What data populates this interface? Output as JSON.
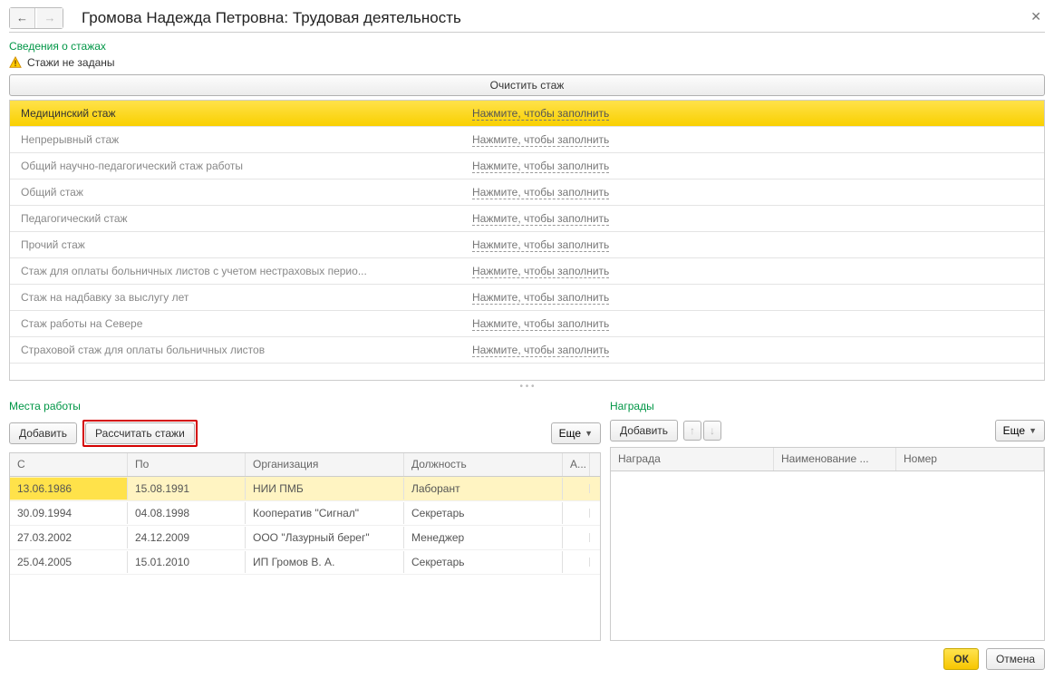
{
  "header": {
    "title": "Громова Надежда Петровна: Трудовая деятельность"
  },
  "seniority": {
    "section_label": "Сведения о стажах",
    "warning_text": "Стажи не заданы",
    "clear_button": "Очистить стаж",
    "fill_link": "Нажмите, чтобы заполнить",
    "rows": [
      {
        "name": "Медицинский стаж"
      },
      {
        "name": "Непрерывный стаж"
      },
      {
        "name": "Общий научно-педагогический стаж работы"
      },
      {
        "name": "Общий стаж"
      },
      {
        "name": "Педагогический стаж"
      },
      {
        "name": "Прочий стаж"
      },
      {
        "name": "Стаж для оплаты больничных листов с учетом нестраховых перио..."
      },
      {
        "name": "Стаж на надбавку за выслугу лет"
      },
      {
        "name": "Стаж работы на Севере"
      },
      {
        "name": "Страховой стаж для оплаты больничных листов"
      }
    ]
  },
  "jobs": {
    "section_label": "Места работы",
    "add_button": "Добавить",
    "recalc_button": "Рассчитать стажи",
    "more_button": "Еще",
    "columns": {
      "from": "С",
      "to": "По",
      "org": "Организация",
      "pos": "Должность",
      "a": "А..."
    },
    "rows": [
      {
        "from": "13.06.1986",
        "to": "15.08.1991",
        "org": "НИИ ПМБ",
        "pos": "Лаборант"
      },
      {
        "from": "30.09.1994",
        "to": "04.08.1998",
        "org": "Кооператив \"Сигнал\"",
        "pos": "Секретарь"
      },
      {
        "from": "27.03.2002",
        "to": "24.12.2009",
        "org": "ООО \"Лазурный берег\"",
        "pos": "Менеджер"
      },
      {
        "from": "25.04.2005",
        "to": "15.01.2010",
        "org": "ИП Громов В. А.",
        "pos": "Секретарь"
      }
    ]
  },
  "awards": {
    "section_label": "Награды",
    "add_button": "Добавить",
    "more_button": "Еще",
    "columns": {
      "award": "Награда",
      "name": "Наименование ...",
      "number": "Номер"
    }
  },
  "footer": {
    "ok": "ОК",
    "cancel": "Отмена"
  }
}
